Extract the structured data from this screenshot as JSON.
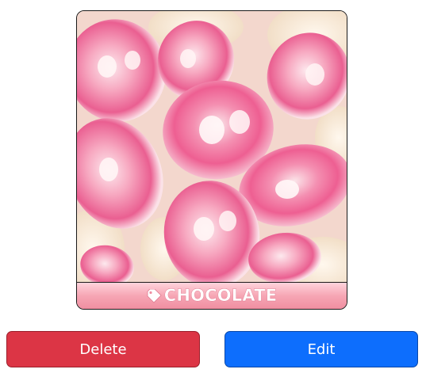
{
  "card": {
    "image_alt": "Pink and white candy pieces",
    "tag_icon": "tag-icon",
    "label": "CHOCOLATE",
    "label_colors": {
      "gradient_top": "#ffd3dc",
      "gradient_bottom": "#f08ea1"
    }
  },
  "actions": {
    "delete_label": "Delete",
    "edit_label": "Edit",
    "delete_color": "#dc3545",
    "edit_color": "#0d6efd"
  }
}
